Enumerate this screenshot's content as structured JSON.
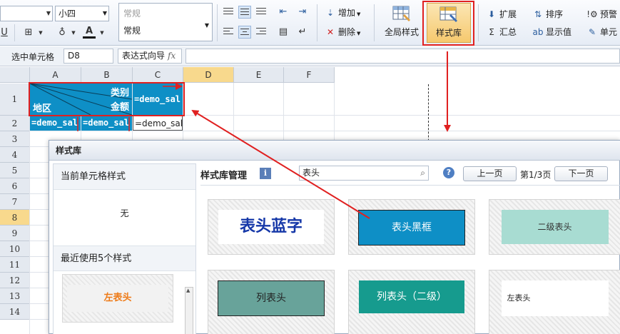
{
  "ribbon": {
    "font_size": "小四",
    "number_format_placeholder": "常规",
    "number_format_value": "常规",
    "btn_add": "增加",
    "btn_delete": "删除",
    "btn_global_style": "全局样式",
    "btn_style_library": "样式库",
    "btn_expand": "扩展",
    "btn_sort": "排序",
    "btn_warning": "预警",
    "btn_summary": "汇总",
    "btn_show_value": "显示值",
    "btn_cell": "单元"
  },
  "formula_bar": {
    "label": "选中单元格",
    "cell_ref": "D8",
    "wizard_label": "表达式向导",
    "fx": "fx"
  },
  "sheet": {
    "columns": [
      "A",
      "B",
      "C",
      "D",
      "E",
      "F"
    ],
    "rows": [
      "1",
      "2",
      "3",
      "4",
      "5",
      "6",
      "7",
      "8",
      "9",
      "10",
      "11",
      "12",
      "13",
      "14"
    ],
    "selected_row": "8",
    "selected_col": "D",
    "header_cell": {
      "top_right": "类别",
      "mid_right": "金额",
      "bottom_left": "地区"
    },
    "c1": "=demo_sal",
    "a2": "=demo_sal",
    "b2": "=demo_sal",
    "c2": "=demo_sale"
  },
  "dialog": {
    "title": "样式库",
    "current_style_label": "当前单元格样式",
    "current_style_value": "无",
    "recent_label": "最近使用5个样式",
    "recent_item": "左表头",
    "manage_title": "样式库管理",
    "info_icon": "i",
    "search_value": "表头",
    "help_icon": "?",
    "prev_page": "上一页",
    "page_info": "第1/3页",
    "next_page": "下一页",
    "styles": [
      {
        "label": "表头蓝字",
        "text_color": "#1537a8",
        "bg": "#ffffff",
        "border": "none"
      },
      {
        "label": "表头黑框",
        "text_color": "#ffffff",
        "bg": "#0e8fc6",
        "border": "#222222"
      },
      {
        "label": "二级表头",
        "text_color": "#333333",
        "bg": "#a8dcd2",
        "border": "none"
      },
      {
        "label": "列表头",
        "text_color": "#222222",
        "bg": "#68a39a",
        "border": "#222222"
      },
      {
        "label": "列表头（二级）",
        "text_color": "#ffffff",
        "bg": "#169b8e",
        "border": "none"
      },
      {
        "label": "左表头",
        "text_color": "#222222",
        "bg": "#ffffff",
        "border": "none"
      }
    ]
  },
  "colors": {
    "accent_blue": "#0e8fc6",
    "selection_gold": "#f8d98d",
    "annotation_red": "#e02020"
  }
}
